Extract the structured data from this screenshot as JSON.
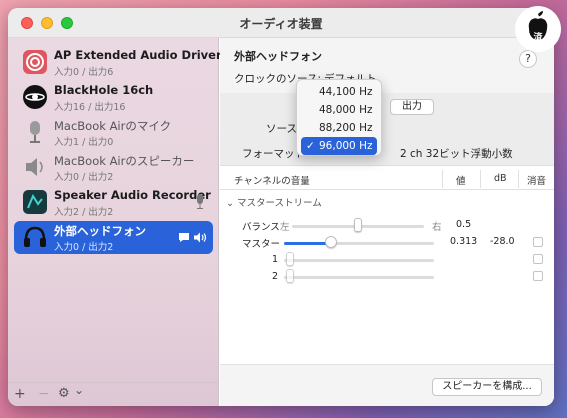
{
  "window": {
    "title": "オーディオ装置"
  },
  "sidebar": {
    "devices": [
      {
        "name": "AP Extended Audio Driver",
        "io": "入力0 / 出力6",
        "icon": "ap-driver-icon"
      },
      {
        "name": "BlackHole 16ch",
        "io": "入力16 / 出力16",
        "icon": "blackhole-icon"
      },
      {
        "name": "MacBook Airのマイク",
        "io": "入力1 / 出力0",
        "icon": "microphone-icon"
      },
      {
        "name": "MacBook Airのスピーカー",
        "io": "入力0 / 出力2",
        "icon": "speaker-icon"
      },
      {
        "name": "Speaker Audio Recorder",
        "io": "入力2 / 出力2",
        "icon": "recorder-icon"
      },
      {
        "name": "外部ヘッドフォン",
        "io": "入力0 / 出力2",
        "icon": "headphones-icon"
      }
    ],
    "footer": {
      "add": "+",
      "remove": "−",
      "gear": "⚙",
      "chevron": "⌄"
    }
  },
  "main": {
    "device_title": "外部ヘッドフォン",
    "help": "?",
    "clock_label": "クロックのソース:",
    "clock_value": "デフォルト",
    "output_tab": "出力",
    "source_label": "ソース",
    "format_label": "フォーマット",
    "format_value": "2 ch 32ビット浮動小数",
    "table": {
      "headers": {
        "channel": "チャンネルの音量",
        "value": "値",
        "db": "dB",
        "mute": "消音"
      },
      "section": "マスターストリーム",
      "balance": {
        "label": "バランス",
        "left": "左",
        "right": "右",
        "value": "0.5",
        "position": 0.5
      },
      "master": {
        "label": "マスター",
        "value": "0.313",
        "db": "-28.0",
        "level": 0.313
      },
      "ch1": {
        "label": "1"
      },
      "ch2": {
        "label": "2"
      }
    },
    "configure_button": "スピーカーを構成..."
  },
  "format_dropdown": {
    "options": [
      "44,100 Hz",
      "48,000 Hz",
      "88,200 Hz",
      "96,000 Hz"
    ],
    "selected": "96,000 Hz",
    "check": "✓"
  },
  "watermark": {
    "text": "済"
  }
}
